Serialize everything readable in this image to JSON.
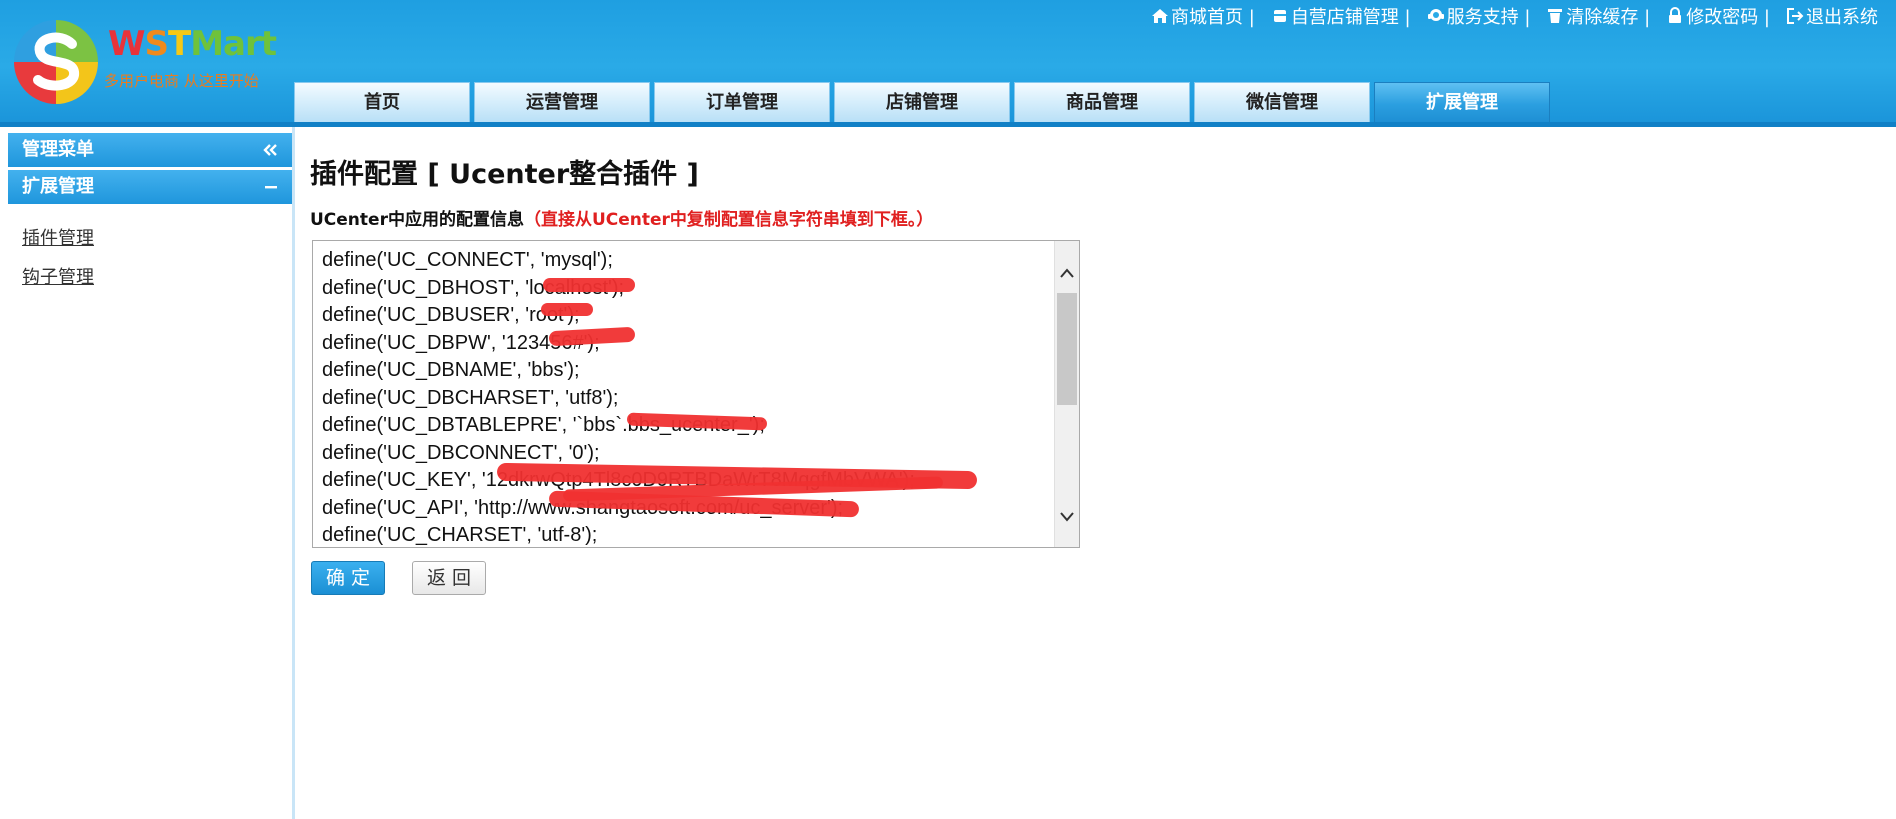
{
  "brand": {
    "letters": [
      "W",
      "S",
      "T",
      "Mart"
    ],
    "slogan": "多用户电商  从这里开始"
  },
  "top_links": [
    {
      "label": "商城首页 |",
      "icon": "home-icon"
    },
    {
      "label": "自营店铺管理 |",
      "icon": "store-icon"
    },
    {
      "label": "服务支持 |",
      "icon": "support-icon"
    },
    {
      "label": "清除缓存 |",
      "icon": "trash-icon"
    },
    {
      "label": "修改密码 |",
      "icon": "lock-icon"
    },
    {
      "label": "退出系统",
      "icon": "logout-icon"
    }
  ],
  "nav_tabs": [
    {
      "label": "首页",
      "active": false
    },
    {
      "label": "运营管理",
      "active": false
    },
    {
      "label": "订单管理",
      "active": false
    },
    {
      "label": "店铺管理",
      "active": false
    },
    {
      "label": "商品管理",
      "active": false
    },
    {
      "label": "微信管理",
      "active": false
    },
    {
      "label": "扩展管理",
      "active": true
    }
  ],
  "sidebar": {
    "menu_title": "管理菜单",
    "section_title": "扩展管理",
    "items": [
      "插件管理",
      "钩子管理"
    ]
  },
  "main": {
    "title": "插件配置 [ Ucenter整合插件 ]",
    "label": "UCenter中应用的配置信息",
    "hint": "（直接从UCenter中复制配置信息字符串填到下框。）",
    "config_lines": [
      "define('UC_CONNECT', 'mysql');",
      "define('UC_DBHOST', 'localhost');",
      "define('UC_DBUSER', 'root');",
      "define('UC_DBPW', '123456#');",
      "define('UC_DBNAME', 'bbs');",
      "define('UC_DBCHARSET', 'utf8');",
      "define('UC_DBTABLEPRE', '`bbs`.bbs_ucenter_');",
      "define('UC_DBCONNECT', '0');",
      "define('UC_KEY', '12dkrwQtp4Tl8c0D9RTBDaWrT8MqgfMbVWA');",
      "define('UC_API', 'http://www.shangtaosoft.com/uc_server');",
      "define('UC_CHARSET', 'utf-8');"
    ],
    "ok_label": "确定",
    "back_label": "返回"
  },
  "colors": {
    "header_blue": "#2aaae7",
    "accent_red": "#e02020",
    "redaction_red": "#f03030"
  }
}
